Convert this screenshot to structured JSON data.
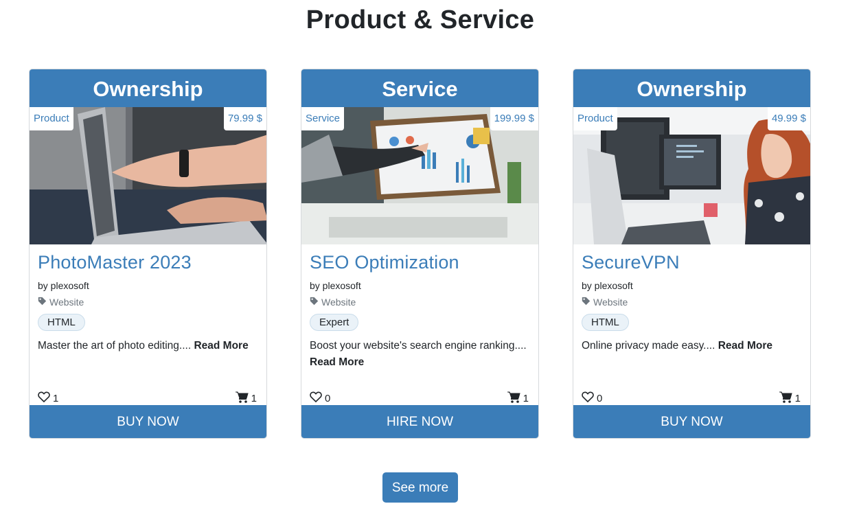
{
  "section": {
    "title": "Product & Service"
  },
  "cards": [
    {
      "header": "Ownership",
      "type": "Product",
      "price": "79.99 $",
      "name": "PhotoMaster 2023",
      "author": "by plexosoft",
      "category": "Website",
      "tag": "HTML",
      "description": "Master the art of photo editing....",
      "read_more": "Read More",
      "likes": "1",
      "cart": "1",
      "action": "BUY NOW"
    },
    {
      "header": "Service",
      "type": "Service",
      "price": "199.99 $",
      "name": "SEO Optimization",
      "author": "by plexosoft",
      "category": "Website",
      "tag": "Expert",
      "description": "Boost your website's search engine ranking....",
      "read_more": "Read More",
      "likes": "0",
      "cart": "1",
      "action": "HIRE NOW"
    },
    {
      "header": "Ownership",
      "type": "Product",
      "price": "49.99 $",
      "name": "SecureVPN",
      "author": "by plexosoft",
      "category": "Website",
      "tag": "HTML",
      "description": "Online privacy made easy....",
      "read_more": "Read More",
      "likes": "0",
      "cart": "1",
      "action": "BUY NOW"
    }
  ],
  "footer": {
    "see_more": "See more"
  },
  "colors": {
    "accent": "#3b7db8",
    "tag_bg": "#eaf2f8"
  },
  "icons": [
    "tag-icon",
    "heart-icon",
    "cart-icon"
  ]
}
